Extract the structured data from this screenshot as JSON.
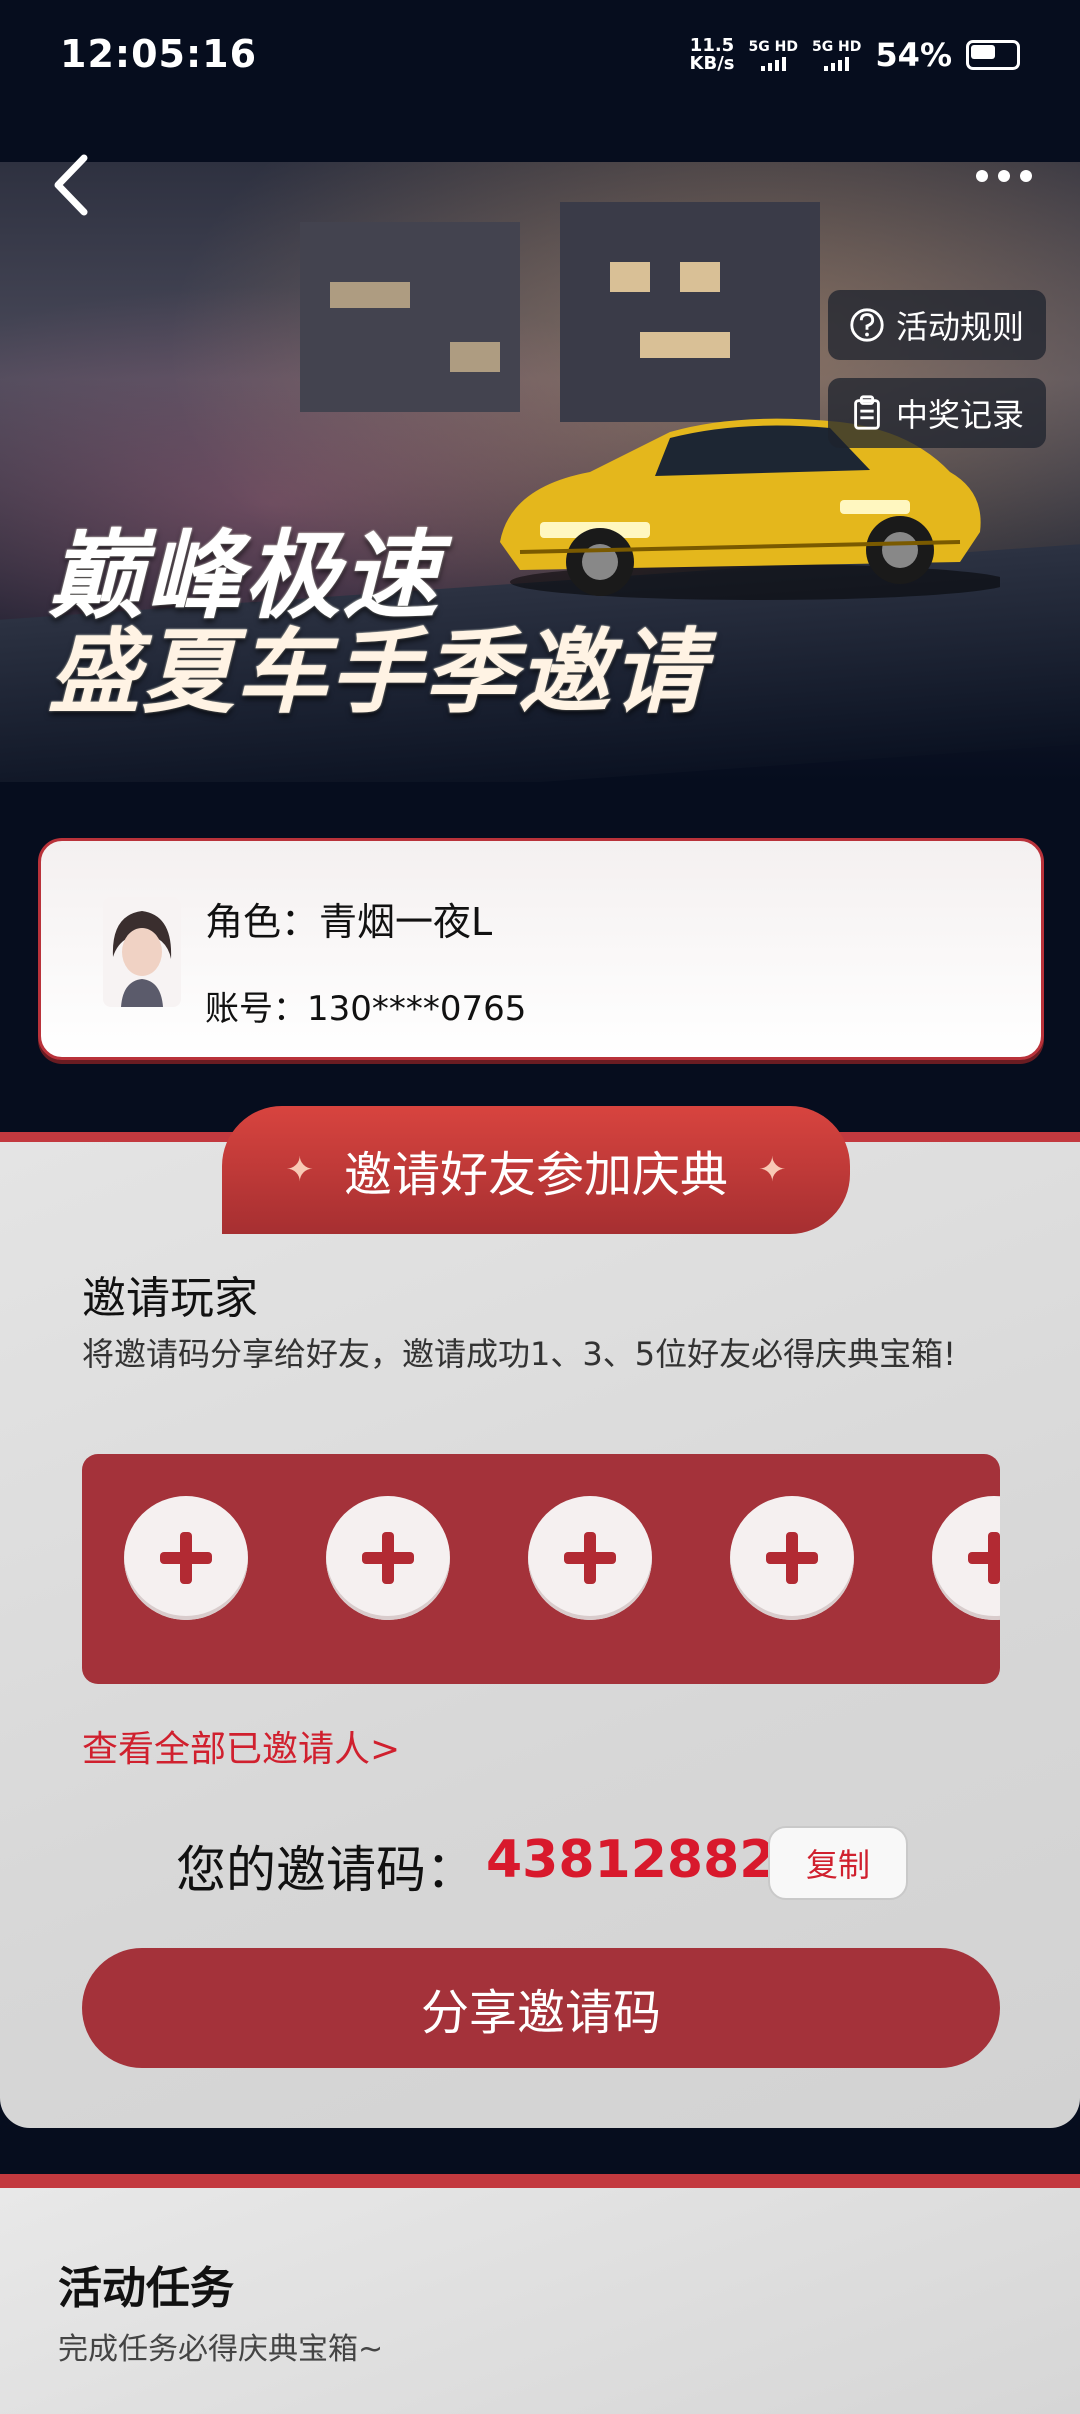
{
  "status_bar": {
    "time": "12:05:16",
    "net_speed_value": "11.5",
    "net_speed_unit": "KB/s",
    "sim1": "5G HD",
    "sim2": "5G HD",
    "battery": "54%"
  },
  "header": {
    "rules_label": "活动规则",
    "records_label": "中奖记录",
    "title_line1": "巅峰极速",
    "title_line2": "盛夏车手季邀请"
  },
  "profile": {
    "role": "角色：青烟一夜L",
    "account": "账号：130****0765"
  },
  "invite": {
    "banner": "邀请好友参加庆典",
    "section_title": "邀请玩家",
    "description": "将邀请码分享给好友，邀请成功1、3、5位好友必得庆典宝箱!",
    "view_all": "查看全部已邀请人>",
    "code_label": "您的邀请码：",
    "code_value": "43812882",
    "copy_label": "复制",
    "share_label": "分享邀请码"
  },
  "tasks": {
    "title": "活动任务",
    "description": "完成任务必得庆典宝箱~"
  },
  "colors": {
    "accent_red": "#a4323a",
    "code_red": "#d8192c",
    "dark_bg": "#060d1e"
  }
}
